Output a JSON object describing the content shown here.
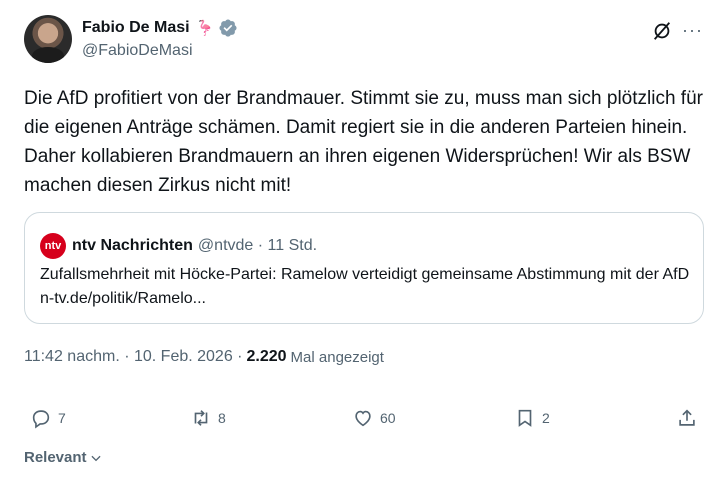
{
  "author": {
    "display_name": "Fabio De Masi",
    "handle": "@FabioDeMasi",
    "emoji": "🦩"
  },
  "tweet": {
    "text": "Die AfD profitiert von der Brandmauer. Stimmt sie zu, muss man sich plötzlich für die eigenen Anträge schämen. Damit regiert sie in die anderen Parteien hinein. Daher kollabieren Brandmauern an ihren eigenen Widersprüchen! Wir als BSW machen diesen Zirkus nicht mit!"
  },
  "quote": {
    "logo_text": "ntv",
    "name": "ntv Nachrichten",
    "handle": "@ntvde · 11 Std.",
    "text": "Zufallsmehrheit mit Höcke-Partei: Ramelow verteidigt gemeinsame Abstimmung mit der AfD n-tv.de/politik/Ramelo..."
  },
  "meta": {
    "time": "11:42 nachm. · 10. Feb. 2026 ·",
    "views": "2.220",
    "views_label": "Mal angezeigt"
  },
  "actions": {
    "replies": "7",
    "reposts": "8",
    "likes": "60",
    "bookmarks": "2"
  },
  "sort": {
    "label": "Relevant"
  },
  "colors": {
    "accent": "#1d9bf0",
    "muted": "#536471",
    "text": "#0f1419",
    "border": "#cfd9de",
    "ntv_red": "#d6001c"
  }
}
